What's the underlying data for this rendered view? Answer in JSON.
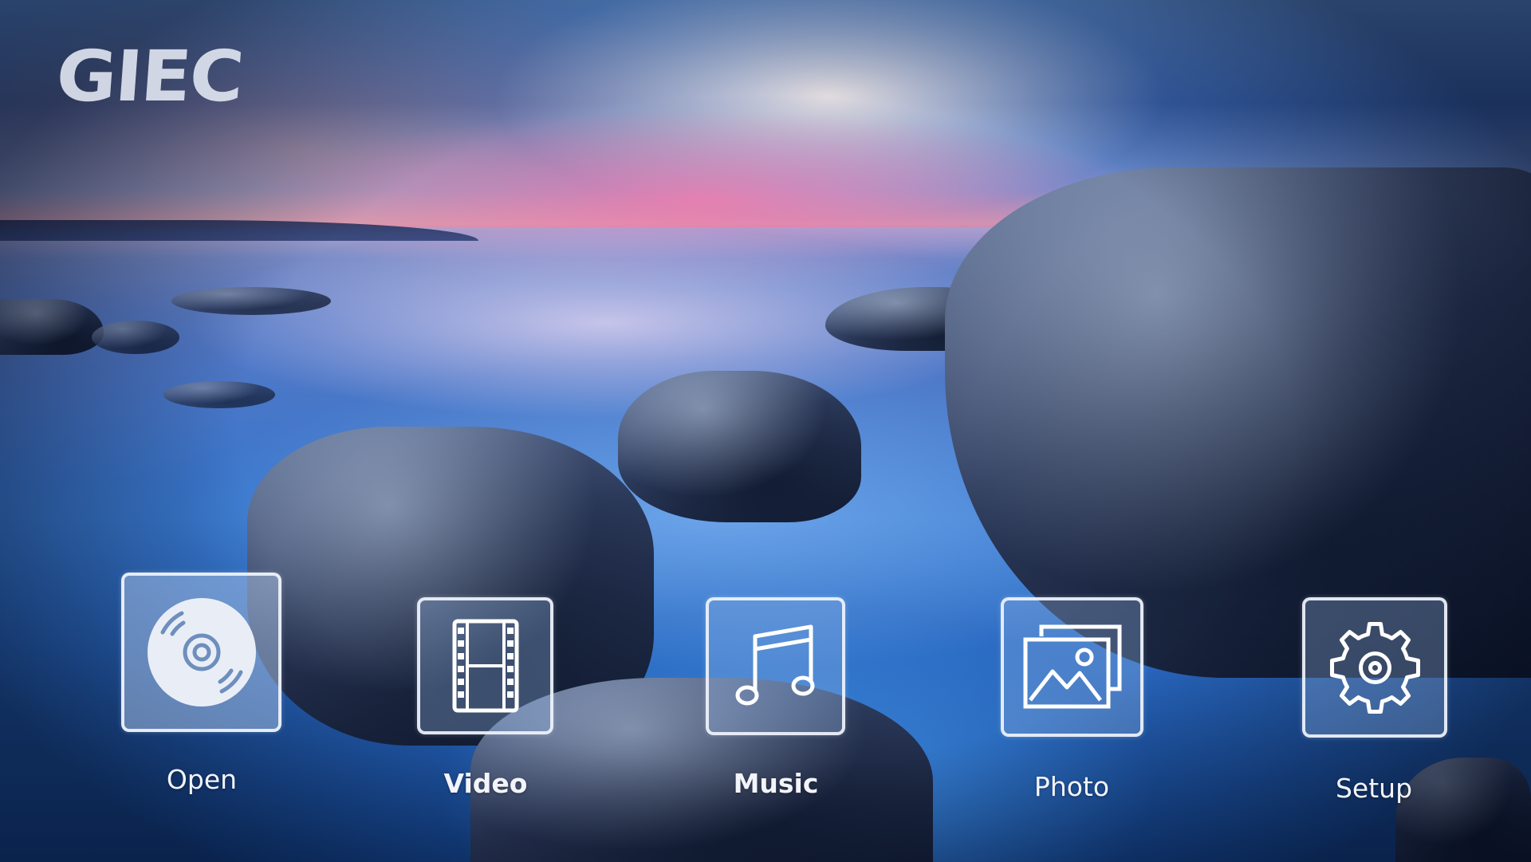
{
  "brand": {
    "logo_text": "GIEC"
  },
  "menu": {
    "selected": "open",
    "items": [
      {
        "id": "open",
        "label": "Open",
        "icon": "disc-icon"
      },
      {
        "id": "video",
        "label": "Video",
        "icon": "film-strip-icon"
      },
      {
        "id": "music",
        "label": "Music",
        "icon": "music-note-icon"
      },
      {
        "id": "photo",
        "label": "Photo",
        "icon": "photo-icon"
      },
      {
        "id": "setup",
        "label": "Setup",
        "icon": "gear-icon"
      }
    ]
  },
  "colors": {
    "tile_border": "#f0f4fc",
    "label_text": "#f2f4fa",
    "icon_stroke": "#ffffff"
  }
}
